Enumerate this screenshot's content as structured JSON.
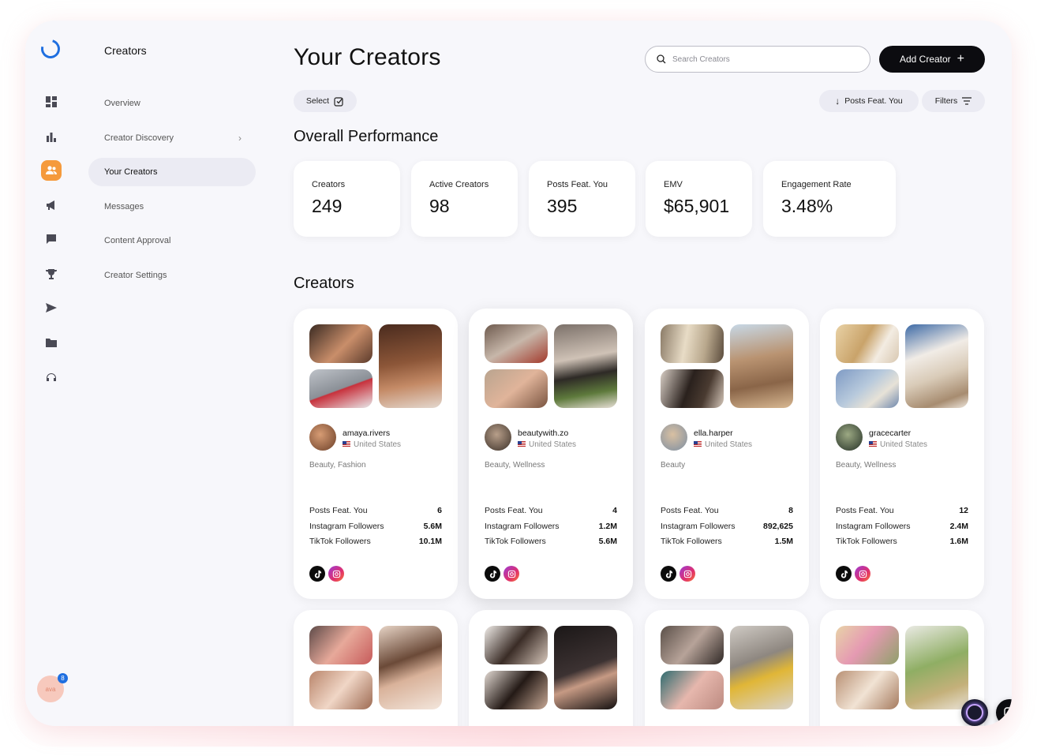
{
  "nav": {
    "title": "Creators",
    "items": [
      {
        "label": "Overview"
      },
      {
        "label": "Creator Discovery"
      },
      {
        "label": "Your Creators"
      },
      {
        "label": "Messages"
      },
      {
        "label": "Content Approval"
      },
      {
        "label": "Creator Settings"
      }
    ]
  },
  "user": {
    "avatar_text": "ava",
    "notification_count": "8"
  },
  "header": {
    "title": "Your Creators",
    "search_placeholder": "Search Creators",
    "add_label": "Add Creator",
    "select_label": "Select",
    "sort_label": "Posts Feat. You",
    "filters_label": "Filters"
  },
  "performance": {
    "title": "Overall Performance",
    "stats": [
      {
        "label": "Creators",
        "value": "249"
      },
      {
        "label": "Active Creators",
        "value": "98"
      },
      {
        "label": "Posts Feat. You",
        "value": "395"
      },
      {
        "label": "EMV",
        "value": "$65,901"
      },
      {
        "label": "Engagement Rate",
        "value": "3.48%"
      }
    ]
  },
  "creators_section": {
    "title": "Creators",
    "metric_labels": [
      "Posts Feat. You",
      "Instagram Followers",
      "TikTok Followers"
    ],
    "cards": [
      {
        "handle": "amaya.rivers",
        "country": "United States",
        "tags": "Beauty, Fashion",
        "posts": "6",
        "instagram": "5.6M",
        "tiktok": "10.1M"
      },
      {
        "handle": "beautywith.zo",
        "country": "United States",
        "tags": "Beauty, Wellness",
        "posts": "4",
        "instagram": "1.2M",
        "tiktok": "5.6M"
      },
      {
        "handle": "ella.harper",
        "country": "United States",
        "tags": "Beauty",
        "posts": "8",
        "instagram": "892,625",
        "tiktok": "1.5M"
      },
      {
        "handle": "gracecarter",
        "country": "United States",
        "tags": "Beauty, Wellness",
        "posts": "12",
        "instagram": "2.4M",
        "tiktok": "1.6M"
      }
    ]
  },
  "colors": {
    "accent": "#f59a3c",
    "primary_button": "#0c0c10",
    "brand_blue": "#1f6fe0"
  }
}
